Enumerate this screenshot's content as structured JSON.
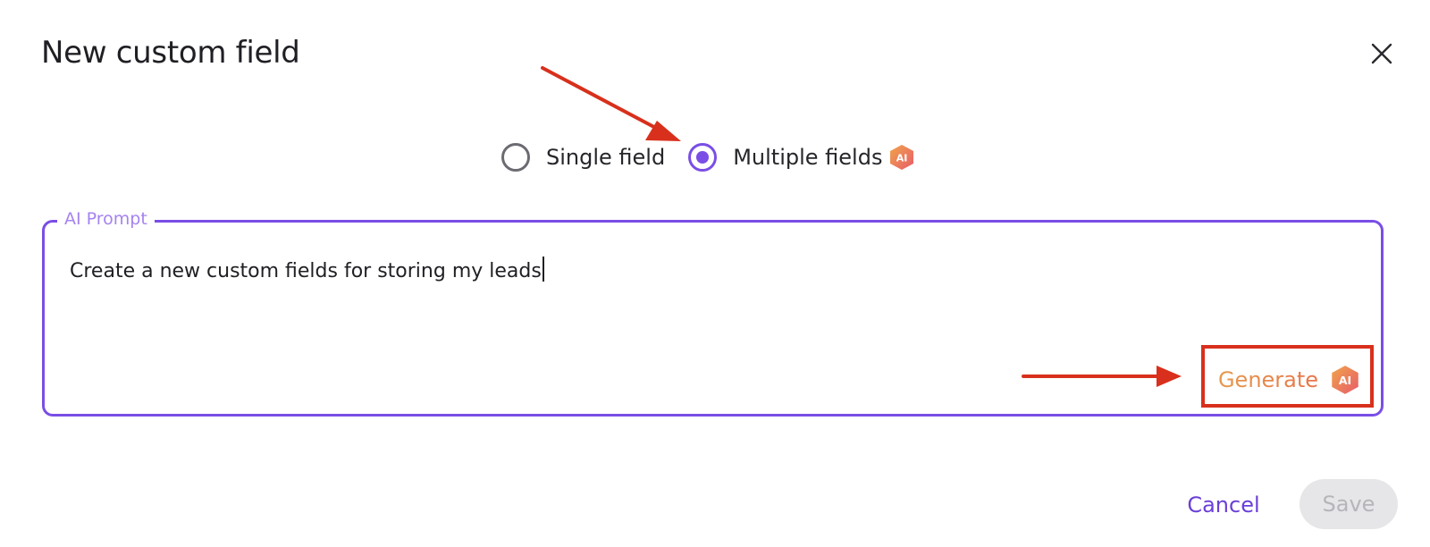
{
  "dialog": {
    "title": "New custom field",
    "close_icon": "close-icon"
  },
  "field_type": {
    "options": [
      {
        "label": "Single field",
        "checked": false
      },
      {
        "label": "Multiple fields",
        "checked": true,
        "badge_icon": "ai-badge-icon"
      }
    ]
  },
  "prompt": {
    "legend": "AI Prompt",
    "value": "Create a new custom fields for storing my leads",
    "generate_label": "Generate",
    "generate_icon": "ai-badge-icon",
    "badge_text": "AI"
  },
  "footer": {
    "cancel_label": "Cancel",
    "save_label": "Save"
  },
  "colors": {
    "accent": "#7a4ee6",
    "generate_gradient_start": "#e59a4e",
    "generate_gradient_end": "#e8734a",
    "annotation_red": "#d8301c",
    "save_disabled_bg": "#e6e6e8",
    "save_disabled_text": "#b5b5ba"
  },
  "annotations": {
    "arrow_icon": "arrow-icon",
    "highlight_box": "highlight-box"
  }
}
